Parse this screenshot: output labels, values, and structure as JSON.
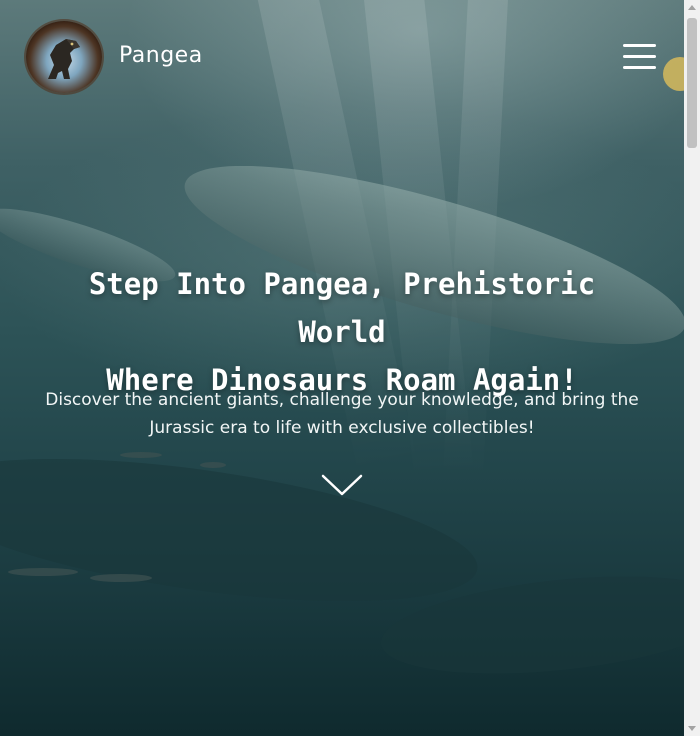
{
  "header": {
    "brand": "Pangea",
    "logo_icon": "t-rex-logo-icon",
    "menu_icon": "hamburger-menu-icon"
  },
  "hero": {
    "headline_line1": "Step Into Pangea, Prehistoric World",
    "headline_line2": "Where Dinosaurs Roam Again!",
    "subtext_line1": "Discover the ancient giants, challenge your knowledge, and bring the",
    "subtext_line2": "Jurassic era to life with exclusive collectibles!",
    "scroll_icon": "chevron-down-icon"
  },
  "colors": {
    "overlay": "#2d5357",
    "text": "#ffffff",
    "cursor_highlight": "#d6ba5c"
  }
}
